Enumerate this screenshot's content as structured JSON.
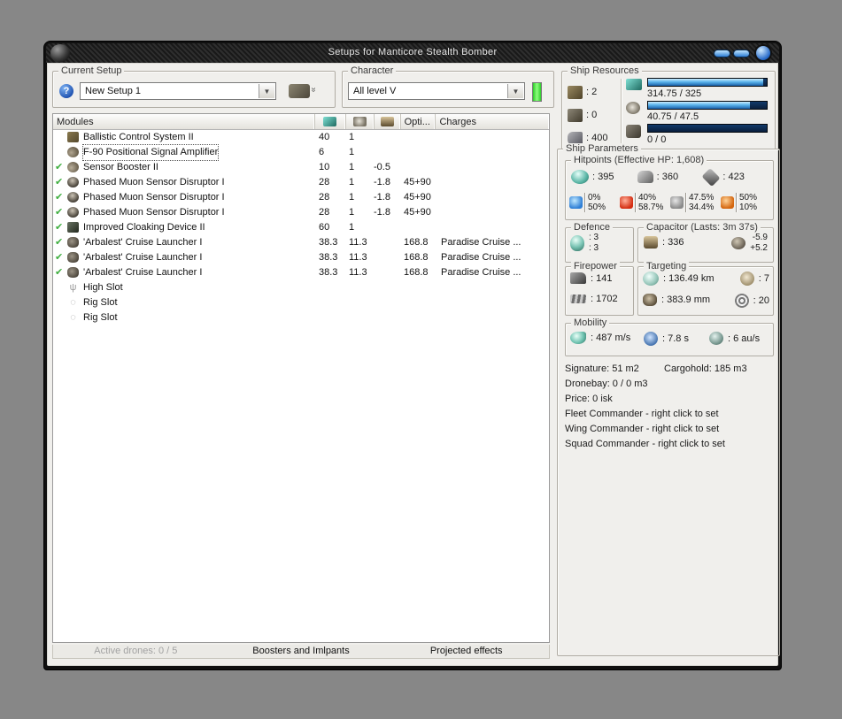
{
  "colors": {
    "bar_fill": "#5ab4ec",
    "bar_track": "#0a1e3c",
    "led_green": "#3ce83c",
    "check_green": "#3fae3f",
    "titlebar": "#1a1a1a"
  },
  "window": {
    "title": "Setups for Manticore Stealth Bomber"
  },
  "current_setup": {
    "label": "Current Setup",
    "value": "New Setup 1"
  },
  "character": {
    "label": "Character",
    "value": "All level V"
  },
  "ship_resources": {
    "label": "Ship Resources",
    "slots": [
      {
        "icon": "turret-hardpoints",
        "value": ": 2"
      },
      {
        "icon": "launcher-hardpoints",
        "value": ": 0"
      },
      {
        "icon": "calibration",
        "value": ": 400"
      }
    ],
    "bars": [
      {
        "icon": "cpu",
        "text": "314.75 / 325",
        "pct": 96.8
      },
      {
        "icon": "powergrid",
        "text": "40.75 / 47.5",
        "pct": 85.8
      },
      {
        "icon": "dronebay",
        "text": "0 / 0",
        "pct": 0
      }
    ]
  },
  "modules_table": {
    "headers": {
      "modules": "Modules",
      "opti": "Opti...",
      "charges": "Charges"
    },
    "rows": [
      {
        "check": false,
        "selected": false,
        "icon": "ballistic-control",
        "name": "Ballistic Control System II",
        "cpu": "40",
        "pg": "1",
        "cap": "",
        "opti": "",
        "charges": ""
      },
      {
        "check": false,
        "selected": true,
        "icon": "signal-amplifier",
        "name": "F-90 Positional Signal Amplifier",
        "cpu": "6",
        "pg": "1",
        "cap": "",
        "opti": "",
        "charges": ""
      },
      {
        "check": true,
        "selected": false,
        "icon": "sensor-booster",
        "name": "Sensor Booster II",
        "cpu": "10",
        "pg": "1",
        "cap": "-0.5",
        "opti": "",
        "charges": ""
      },
      {
        "check": true,
        "selected": false,
        "icon": "sensor-disruptor",
        "name": "Phased Muon Sensor Disruptor I",
        "cpu": "28",
        "pg": "1",
        "cap": "-1.8",
        "opti": "45+90",
        "charges": ""
      },
      {
        "check": true,
        "selected": false,
        "icon": "sensor-disruptor",
        "name": "Phased Muon Sensor Disruptor I",
        "cpu": "28",
        "pg": "1",
        "cap": "-1.8",
        "opti": "45+90",
        "charges": ""
      },
      {
        "check": true,
        "selected": false,
        "icon": "sensor-disruptor",
        "name": "Phased Muon Sensor Disruptor I",
        "cpu": "28",
        "pg": "1",
        "cap": "-1.8",
        "opti": "45+90",
        "charges": ""
      },
      {
        "check": true,
        "selected": false,
        "icon": "cloaking-device",
        "name": "Improved Cloaking Device II",
        "cpu": "60",
        "pg": "1",
        "cap": "",
        "opti": "",
        "charges": ""
      },
      {
        "check": true,
        "selected": false,
        "icon": "cruise-launcher",
        "name": "'Arbalest' Cruise Launcher I",
        "cpu": "38.3",
        "pg": "11.3",
        "cap": "",
        "opti": "168.8",
        "charges": "Paradise Cruise ..."
      },
      {
        "check": true,
        "selected": false,
        "icon": "cruise-launcher",
        "name": "'Arbalest' Cruise Launcher I",
        "cpu": "38.3",
        "pg": "11.3",
        "cap": "",
        "opti": "168.8",
        "charges": "Paradise Cruise ..."
      },
      {
        "check": true,
        "selected": false,
        "icon": "cruise-launcher",
        "name": "'Arbalest' Cruise Launcher I",
        "cpu": "38.3",
        "pg": "11.3",
        "cap": "",
        "opti": "168.8",
        "charges": "Paradise Cruise ..."
      },
      {
        "check": false,
        "selected": false,
        "icon": "high-slot",
        "glyph": "ψ",
        "name": "High Slot",
        "cpu": "",
        "pg": "",
        "cap": "",
        "opti": "",
        "charges": ""
      },
      {
        "check": false,
        "selected": false,
        "icon": "rig-slot",
        "glyph": "◌",
        "name": "Rig Slot",
        "cpu": "",
        "pg": "",
        "cap": "",
        "opti": "",
        "charges": ""
      },
      {
        "check": false,
        "selected": false,
        "icon": "rig-slot",
        "glyph": "◌",
        "name": "Rig Slot",
        "cpu": "",
        "pg": "",
        "cap": "",
        "opti": "",
        "charges": ""
      }
    ]
  },
  "bottom_bar": {
    "active_drones": "Active drones: 0 / 5",
    "boosters": "Boosters and Imlpants",
    "projected": "Projected effects"
  },
  "ship_parameters": {
    "label": "Ship Parameters",
    "hitpoints": {
      "label": "Hitpoints (Effective HP: 1,608)",
      "stats": [
        {
          "icon": "shield",
          "value": ": 395"
        },
        {
          "icon": "armor",
          "value": ": 360"
        },
        {
          "icon": "structure",
          "value": ": 423"
        }
      ],
      "resists": [
        {
          "icon": "em",
          "shield": "0%",
          "armor": "50%"
        },
        {
          "icon": "thermal",
          "shield": "40%",
          "armor": "58.7%"
        },
        {
          "icon": "kinetic",
          "shield": "47.5%",
          "armor": "34.4%"
        },
        {
          "icon": "explosive",
          "shield": "50%",
          "armor": "10%"
        }
      ]
    },
    "defence": {
      "label": "Defence",
      "shield_rate": ": 3",
      "armor_rate": ": 3"
    },
    "capacitor": {
      "label": "Capacitor (Lasts: 3m 37s)",
      "amount": ": 336",
      "drain": "-5.9",
      "recharge": "+5.2"
    },
    "firepower": {
      "label": "Firepower",
      "turret_dps": ": 141",
      "missile_dps": ": 1702"
    },
    "targeting": {
      "label": "Targeting",
      "range": ": 136.49 km",
      "max_targets": ": 7",
      "scan_resolution": ": 383.9 mm",
      "sensor_strength": ": 20"
    },
    "mobility": {
      "label": "Mobility",
      "speed": ": 487 m/s",
      "align_time": ": 7.8 s",
      "warp_speed": ": 6 au/s"
    },
    "info": {
      "signature": "Signature: 51 m2",
      "cargohold": "Cargohold: 185 m3",
      "dronebay": "Dronebay: 0 / 0 m3",
      "price": "Price: 0 isk",
      "fleet": "Fleet Commander - right click to set",
      "wing": "Wing Commander - right click to set",
      "squad": "Squad Commander - right click to set"
    }
  }
}
